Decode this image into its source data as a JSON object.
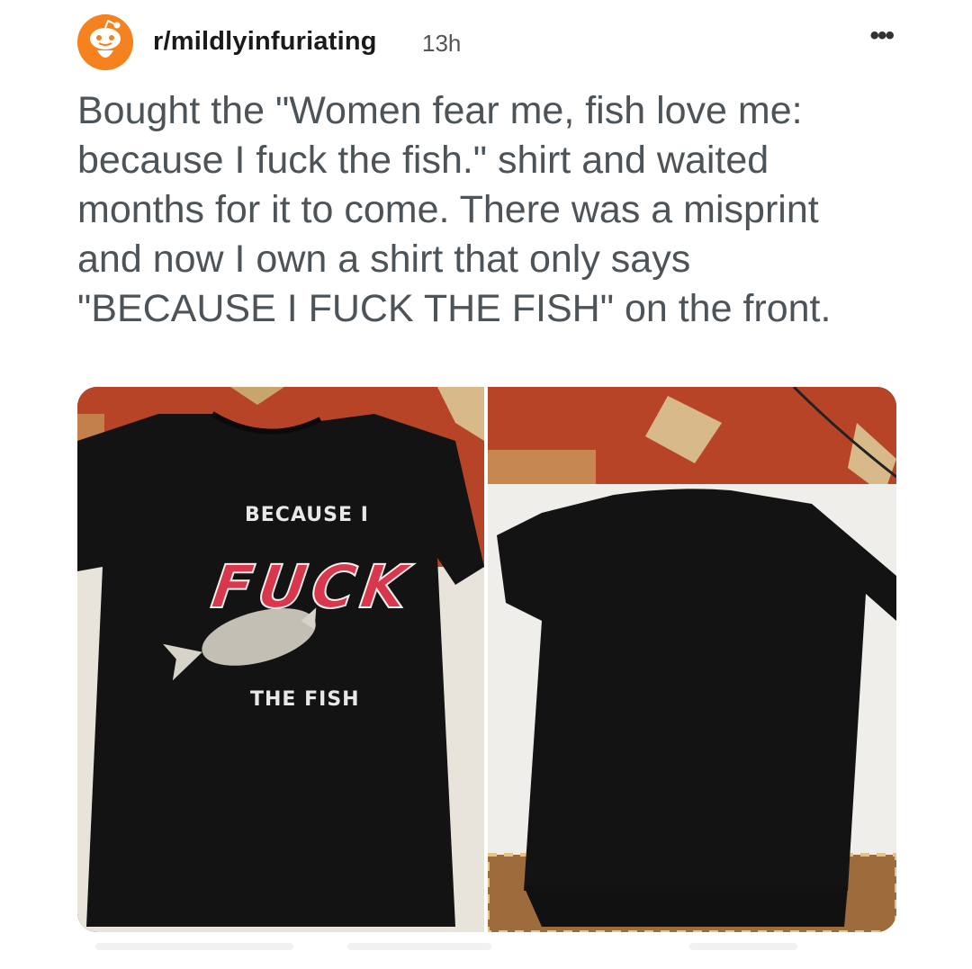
{
  "post": {
    "subreddit": "r/mildlyinfuriating",
    "time_ago": "13h",
    "more_icon": "more-horizontal-icon",
    "title": "Bought the \"Women fear me, fish love me: because I fuck the fish.\" shirt and waited months for it to come. There was a misprint and now I own a shirt that only says \"BECAUSE I FUCK THE FISH\" on the front."
  },
  "gallery": {
    "front_shirt": {
      "line1": "BECAUSE I",
      "line2": "FUCK",
      "line3": "THE FISH"
    }
  },
  "colors": {
    "avatar": "#f5821f",
    "title_text": "#4d5459",
    "shirt": "#121212",
    "print_red": "#d9374b",
    "floor_red": "#b84428"
  }
}
